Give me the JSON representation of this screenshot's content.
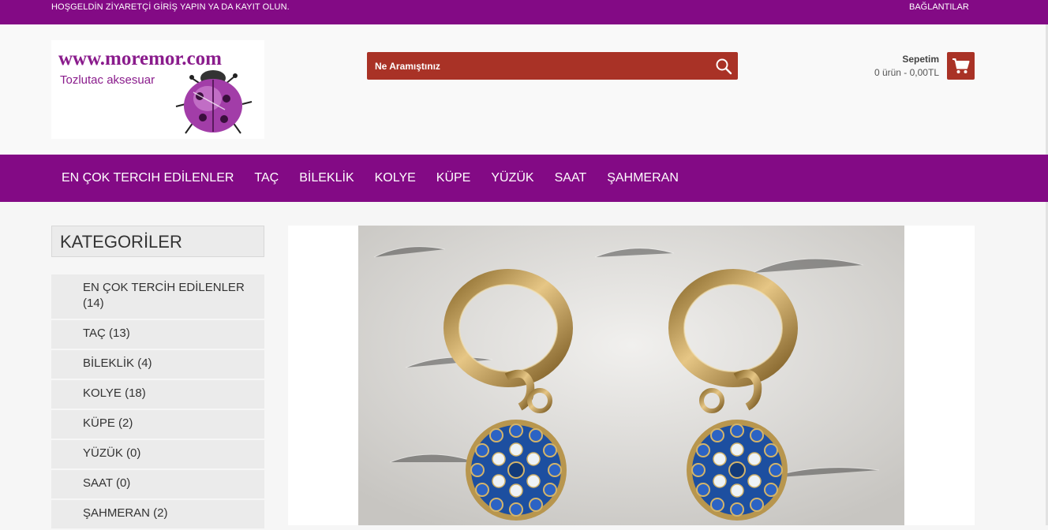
{
  "topbar": {
    "welcome": "HOŞGELDİN ZİYARETÇİ GİRİŞ YAPIN YA DA KAYIT OLUN.",
    "links_label": "BAĞLANTILAR"
  },
  "logo": {
    "url_text": "www.moremor.com",
    "tagline": "Tozlutac aksesuar"
  },
  "search": {
    "placeholder": "Ne Aramıştınız",
    "icon": "search-icon"
  },
  "cart": {
    "title": "Sepetim",
    "summary": "0 ürün - 0,00TL",
    "icon": "shopping-cart-icon"
  },
  "nav": {
    "items": [
      "EN ÇOK TERCIH EDİLENLER",
      "TAÇ",
      "BİLEKLİK",
      "KOLYE",
      "KÜPE",
      "YÜZÜK",
      "SAAT",
      "ŞAHMERAN"
    ]
  },
  "sidebar": {
    "heading": "KATEGORİLER",
    "categories": [
      "EN ÇOK TERCİH EDİLENLER (14)",
      "TAÇ (13)",
      "BİLEKLİK (4)",
      "KOLYE (18)",
      "KÜPE (2)",
      "YÜZÜK (0)",
      "SAAT (0)",
      "ŞAHMERAN (2)"
    ]
  },
  "colors": {
    "brand_purple": "#830a85",
    "accent_red": "#a93226",
    "stone_blue": "#1d4fa0",
    "gold": "#c9a055"
  }
}
